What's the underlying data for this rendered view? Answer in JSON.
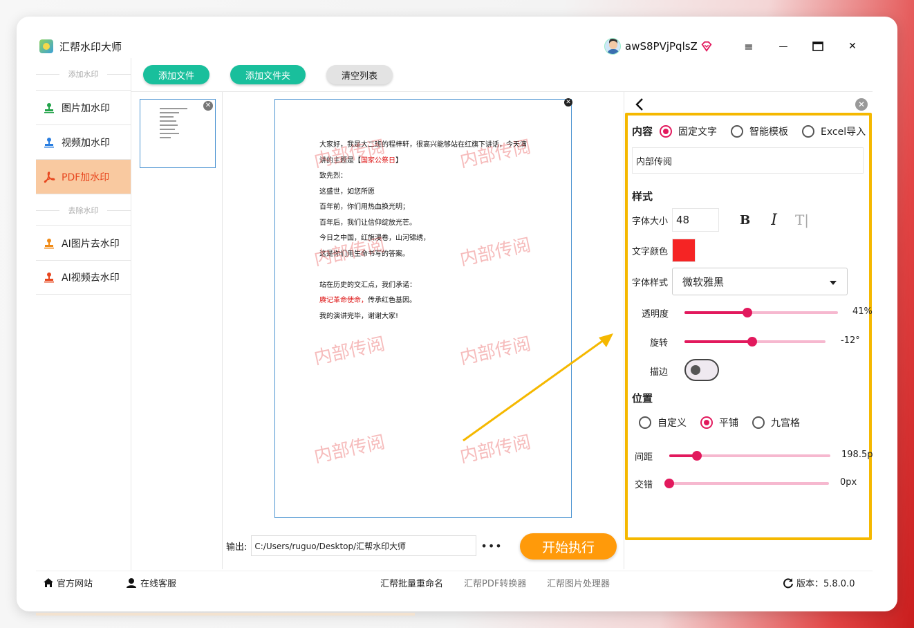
{
  "app": {
    "title": "汇帮水印大师",
    "username": "awS8PVjPqlsZ"
  },
  "window_controls": {
    "menu": "≡",
    "minimize": "—",
    "maximize": "▭",
    "close": "✕"
  },
  "sidebar": {
    "section_add": "添加水印",
    "section_remove": "去除水印",
    "items": [
      {
        "label": "图片加水印",
        "color": "#22a34a"
      },
      {
        "label": "视频加水印",
        "color": "#2a7ee0"
      },
      {
        "label": "PDF加水印",
        "color": "#e8461e"
      },
      {
        "label": "AI图片去水印",
        "color": "#f08a16"
      },
      {
        "label": "AI视频去水印",
        "color": "#e8461e"
      }
    ],
    "active_index": 2
  },
  "toolbar": {
    "add_file": "添加文件",
    "add_folder": "添加文件夹",
    "clear_list": "清空列表"
  },
  "document": {
    "lines": [
      "大家好，我是大二班的程梓轩，很高兴能够站在红旗下讲话，今天演",
      "讲的主题是【",
      "致先烈：",
      "这盛世，如您所愿",
      "百年前，你们用热血换光明；",
      "百年后，我们让信仰绽放光芒。",
      "今日之中国，红旗漫卷，山河锦绣，",
      "这是你们用生命书写的答案。",
      "",
      "站在历史的交汇点，我们承诺：",
      "传承红色基因。",
      "我的演讲完毕，谢谢大家!"
    ],
    "highlight_topic": "国家公祭日",
    "topic_close": "】",
    "highlight_vow": "赓记革命使命，",
    "watermark_text": "内部传阅"
  },
  "output": {
    "label": "输出:",
    "path": "C:/Users/ruguo/Desktop/汇帮水印大师",
    "more": "•••"
  },
  "start_button": "开始执行",
  "panel": {
    "content_label": "内容",
    "content_options": [
      "固定文字",
      "智能模板",
      "Excel导入"
    ],
    "content_selected": 0,
    "text_value": "内部传阅",
    "style_label": "样式",
    "font_size_label": "字体大小",
    "font_size_value": "48",
    "bold_glyph": "B",
    "italic_glyph": "I",
    "strike_glyph": "T|",
    "font_color_label": "文字颜色",
    "font_color": "#f52424",
    "font_style_label": "字体样式",
    "font_style_value": "微软雅黑",
    "opacity_label": "透明度",
    "opacity_value": "41%",
    "opacity_fraction": 0.41,
    "rotate_label": "旋转",
    "rotate_value": "-12°",
    "rotate_fraction": 0.48,
    "stroke_label": "描边",
    "position_label": "位置",
    "position_options": [
      "自定义",
      "平铺",
      "九宫格"
    ],
    "position_selected": 1,
    "spacing_label": "间距",
    "spacing_value": "198.5p",
    "spacing_fraction": 0.17,
    "stagger_label": "交错",
    "stagger_value": "0px",
    "stagger_fraction": 0.0
  },
  "footer": {
    "website": "官方网站",
    "service": "在线客服",
    "link1": "汇帮批量重命名",
    "link2": "汇帮PDF转换器",
    "link3": "汇帮图片处理器",
    "version": "版本：5.8.0.0"
  },
  "accent_colors": {
    "pink": "#e2195d",
    "highlight_border": "#f5b800",
    "green_button": "#19bf9c",
    "orange_button": "#ff9a0a"
  }
}
